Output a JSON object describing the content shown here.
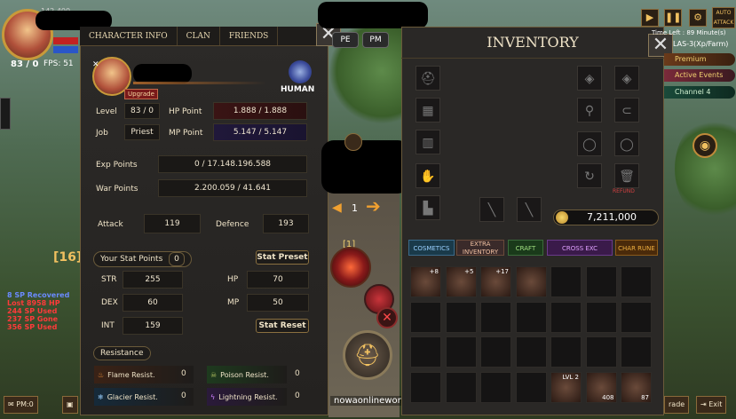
{
  "hud": {
    "level_text": "83 / 0",
    "fps_text": "FPS: 51",
    "top_number": "142,400"
  },
  "char_panel": {
    "tabs": [
      "CHARACTER INFO",
      "CLAN",
      "FRIENDS"
    ],
    "upgrade_label": "Upgrade",
    "race": "HUMAN",
    "level_label": "Level",
    "level_value": "83 / 0",
    "job_label": "Job",
    "job_value": "Priest",
    "hp_label": "HP Point",
    "hp_value": "1.888 / 1.888",
    "mp_label": "MP Point",
    "mp_value": "5.147 / 5.147",
    "exp_label": "Exp Points",
    "exp_value": "0 / 17.148.196.588",
    "war_label": "War Points",
    "war_value": "2.200.059 / 41.641",
    "attack_label": "Attack",
    "attack_value": "119",
    "defence_label": "Defence",
    "defence_value": "193",
    "stat_points_label": "Your Stat Points",
    "stat_points_value": "0",
    "stat_preset_label": "Stat Preset",
    "stat_reset_label": "Stat Reset",
    "stats": {
      "str_label": "STR",
      "str_value": "255",
      "dex_label": "DEX",
      "dex_value": "60",
      "int_label": "INT",
      "int_value": "159",
      "hp_label": "HP",
      "hp_value": "70",
      "mp_label": "MP",
      "mp_value": "50"
    },
    "resistance_label": "Resistance",
    "resist": {
      "flame_label": "Flame Resist.",
      "flame_value": "0",
      "poison_label": "Poison Resist.",
      "poison_value": "0",
      "glacier_label": "Glacier Resist.",
      "glacier_value": "0",
      "lightning_label": "Lightning Resist.",
      "lightning_value": "0"
    }
  },
  "inventory": {
    "title": "INVENTORY",
    "refund_label": "REFUND",
    "gold": "7,211,000",
    "tabs": [
      "COSMETICS",
      "EXTRA INVENTORY",
      "CRAFT",
      "CROSS EXC",
      "CHAR RUNE"
    ],
    "items": [
      {
        "top": "+8"
      },
      {
        "top": "+5"
      },
      {
        "top": "+17"
      },
      {
        "top": ""
      },
      {
        "top": "LVL 2",
        "count": ""
      },
      {
        "count": "408"
      },
      {
        "count": "87"
      }
    ]
  },
  "right_hud": {
    "time_left": "Time Left : 89 Minute(s)",
    "server": "LAS-3(Xp/Farm)",
    "auto_attack": "AUTO ATTACK",
    "premium": "Premium",
    "active_events": "Active Events",
    "channel": "Channel 4"
  },
  "center": {
    "pe_label": "PE",
    "pm_label": "PM",
    "skill_level": "[1]",
    "count_label": "1"
  },
  "chat": {
    "level_badge": "[16]",
    "lines": [
      "8 SP Recovered",
      "Lost 8958 HP",
      "244 SP Used",
      "237 SP Gone",
      "356 SP Used"
    ]
  },
  "bottom": {
    "pm_button": "PM:0",
    "website": "nowaonlineworld",
    "trade_label": "rade",
    "exit_label": "Exit"
  },
  "colors": {
    "panel_bg": "#2a2826",
    "gold_border": "#8a7040",
    "hp_red": "#c32222",
    "mp_blue": "#2a56c8"
  }
}
